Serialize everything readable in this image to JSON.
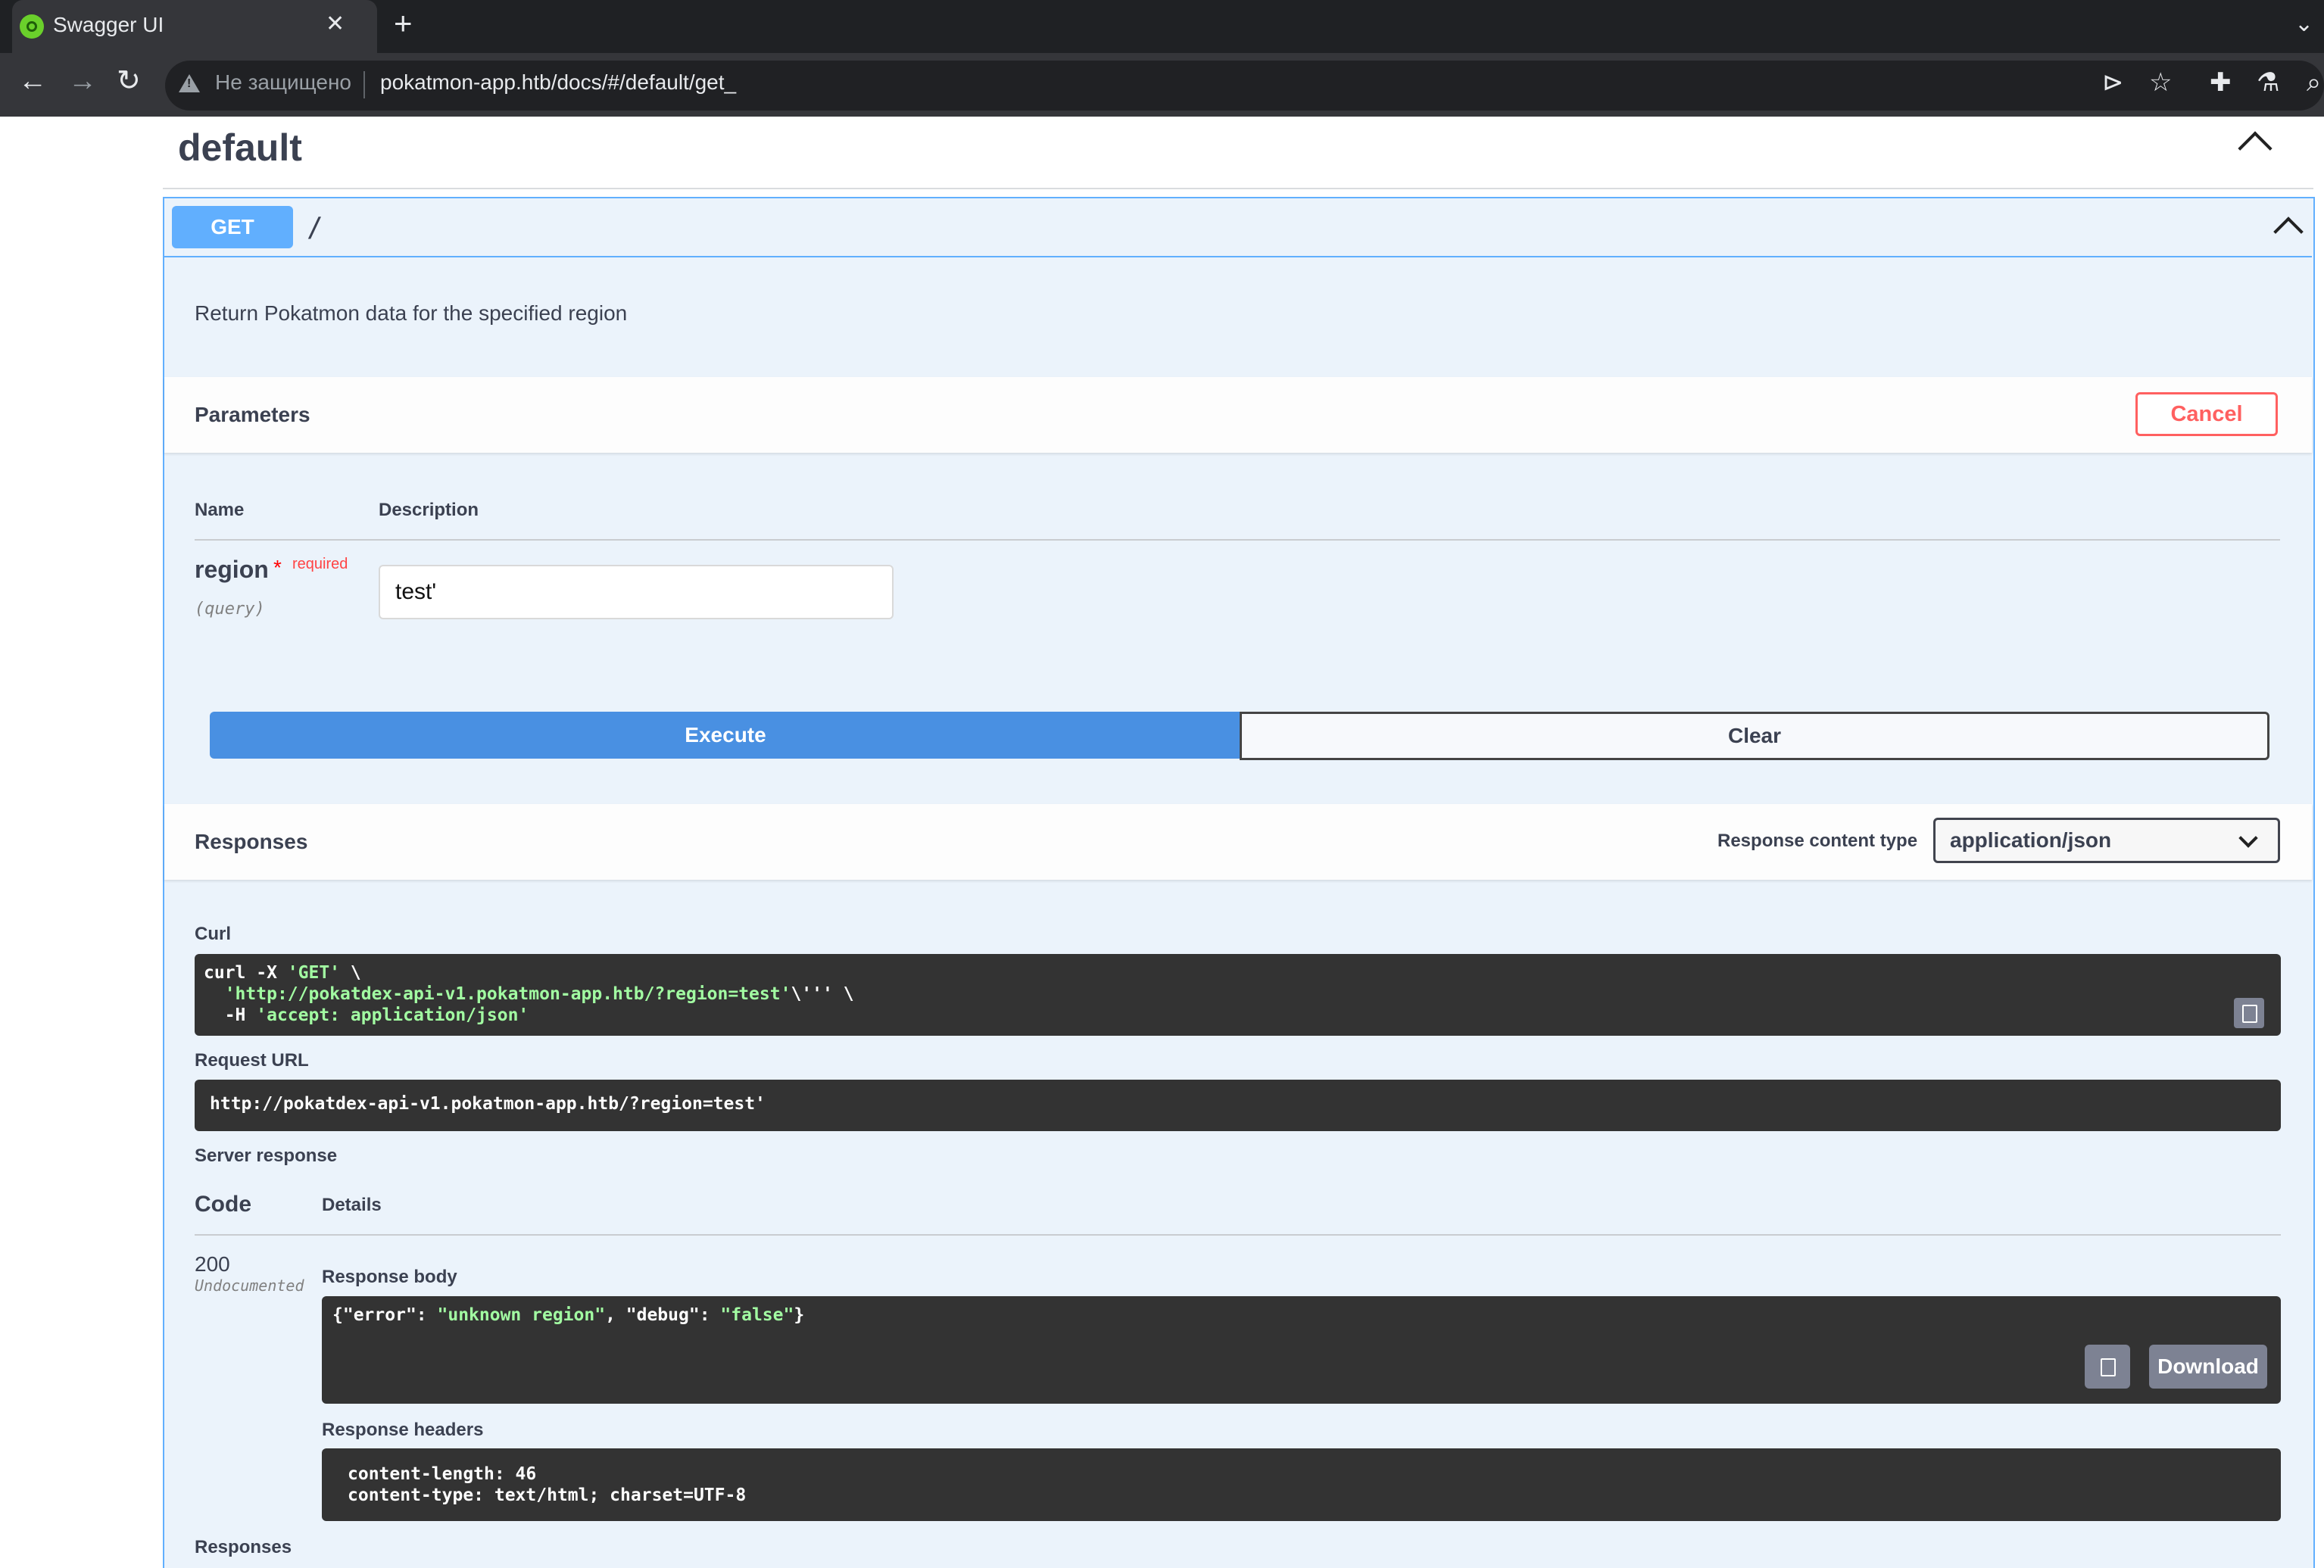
{
  "browser": {
    "tab_title": "Swagger UI",
    "tab_close": "✕",
    "new_tab": "+",
    "not_secure_label": "Не защищено",
    "url": "pokatmon-app.htb/docs/#/default/get_",
    "icons": [
      "back-icon",
      "forward-icon",
      "reload-icon",
      "warning-icon",
      "send-icon",
      "star-icon",
      "extensions-icon",
      "labs-icon",
      "search-icon"
    ]
  },
  "section": {
    "title": "default"
  },
  "operation": {
    "method": "GET",
    "path": "/",
    "description": "Return Pokatmon data for the specified region",
    "accent_color": "#61affe"
  },
  "parameters": {
    "title": "Parameters",
    "cancel_label": "Cancel",
    "col_name": "Name",
    "col_description": "Description",
    "items": [
      {
        "name": "region",
        "required_star": "*",
        "required_label": "required",
        "in": "(query)",
        "value": "test'"
      }
    ]
  },
  "actions": {
    "execute_label": "Execute",
    "clear_label": "Clear",
    "execute_color": "#4990e2"
  },
  "responses": {
    "title": "Responses",
    "content_type_label": "Response content type",
    "content_type_value": "application/json",
    "curl_label": "Curl",
    "curl_lines": [
      {
        "prefix": "curl -X ",
        "str": "'GET'",
        "suffix": " \\"
      },
      {
        "prefix": "  ",
        "str": "'http://pokatdex-api-v1.pokatmon-app.htb/?region=test'",
        "suffix": "\\''' \\"
      },
      {
        "prefix": "  -H ",
        "str": "'accept: application/json'",
        "suffix": ""
      }
    ],
    "request_url_label": "Request URL",
    "request_url": "http://pokatdex-api-v1.pokatmon-app.htb/?region=test'",
    "server_response_label": "Server response",
    "code_header": "Code",
    "details_header": "Details",
    "status_code": "200",
    "status_note": "Undocumented",
    "body_label": "Response body",
    "body": {
      "open": "{",
      "k1": "\"error\"",
      "sep1": ": ",
      "v1": "\"unknown region\"",
      "comma": ", ",
      "k2": "\"debug\"",
      "sep2": ": ",
      "v2": "\"false\"",
      "close": "}"
    },
    "download_label": "Download",
    "headers_label": "Response headers",
    "headers": [
      "content-length: 46",
      "content-type: text/html; charset=UTF-8"
    ],
    "footer_label": "Responses"
  }
}
